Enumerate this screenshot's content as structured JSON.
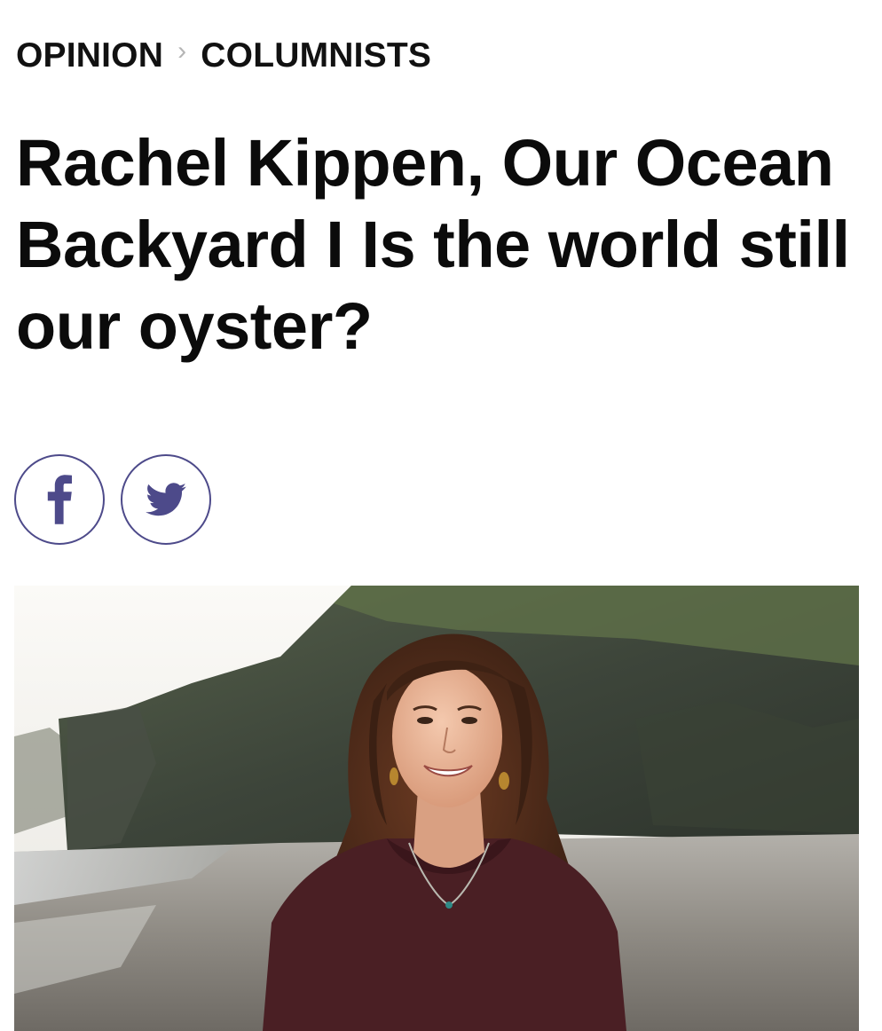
{
  "breadcrumb": {
    "items": [
      {
        "label": "OPINION"
      },
      {
        "label": "COLUMNISTS"
      }
    ],
    "separator": "›"
  },
  "article": {
    "headline": "Rachel Kippen, Our Ocean Backyard I Is the world still our oyster?"
  },
  "share": {
    "buttons": [
      {
        "icon": "facebook-icon"
      },
      {
        "icon": "twitter-icon"
      }
    ],
    "accent_color": "#4d4a8a"
  }
}
